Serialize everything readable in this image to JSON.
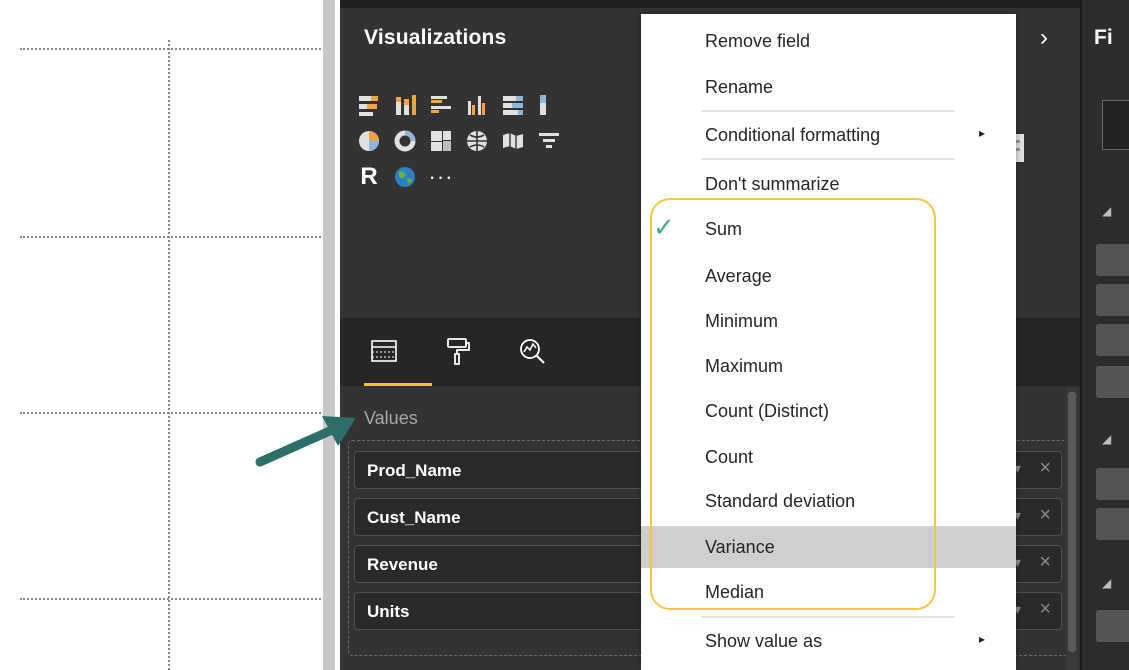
{
  "visualizations_pane": {
    "title": "Visualizations",
    "collapse_glyph": "›",
    "values_well": {
      "label": "Values",
      "fields": [
        {
          "name": "Prod_Name"
        },
        {
          "name": "Cust_Name"
        },
        {
          "name": "Revenue"
        },
        {
          "name": "Units"
        }
      ],
      "remove_glyph": "×",
      "dropdown_glyph": "▾"
    },
    "more_visuals_glyph": "···",
    "r_visual_glyph": "R",
    "tabs": [
      {
        "icon": "fields-tab-icon"
      },
      {
        "icon": "format-paint-roller-icon"
      },
      {
        "icon": "analytics-magnifier-icon"
      }
    ]
  },
  "fields_pane": {
    "title": "Fi"
  },
  "context_menu": {
    "items": [
      {
        "label": "Remove field"
      },
      {
        "label": "Rename"
      },
      {
        "label": "Conditional formatting",
        "submenu": "▸"
      },
      {
        "label": "Don't summarize"
      },
      {
        "label": "Sum",
        "checked": true,
        "check_glyph": "✓"
      },
      {
        "label": "Average"
      },
      {
        "label": "Minimum"
      },
      {
        "label": "Maximum"
      },
      {
        "label": "Count (Distinct)"
      },
      {
        "label": "Count"
      },
      {
        "label": "Standard deviation"
      },
      {
        "label": "Variance",
        "hovered": true
      },
      {
        "label": "Median"
      },
      {
        "label": "Show value as",
        "submenu": "▸"
      }
    ]
  },
  "colors": {
    "accent_yellow": "#f2c811",
    "highlight_ring": "#f6c544",
    "check_teal": "#43a88a",
    "arrow_teal": "#2e6e68",
    "pane_bg": "#333333",
    "hover_bg": "#cfcfcf"
  }
}
